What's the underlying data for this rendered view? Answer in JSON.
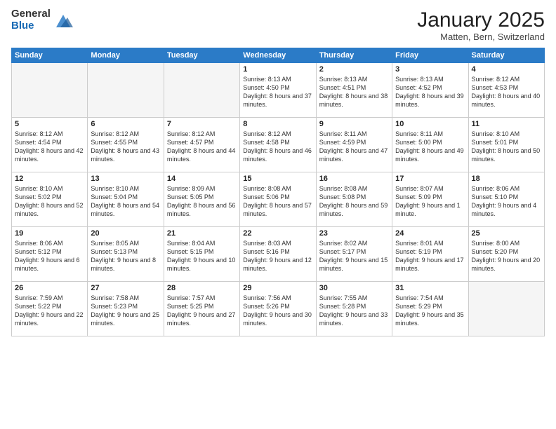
{
  "logo": {
    "general": "General",
    "blue": "Blue"
  },
  "header": {
    "title": "January 2025",
    "location": "Matten, Bern, Switzerland"
  },
  "weekdays": [
    "Sunday",
    "Monday",
    "Tuesday",
    "Wednesday",
    "Thursday",
    "Friday",
    "Saturday"
  ],
  "weeks": [
    [
      {
        "day": "",
        "info": ""
      },
      {
        "day": "",
        "info": ""
      },
      {
        "day": "",
        "info": ""
      },
      {
        "day": "1",
        "info": "Sunrise: 8:13 AM\nSunset: 4:50 PM\nDaylight: 8 hours\nand 37 minutes."
      },
      {
        "day": "2",
        "info": "Sunrise: 8:13 AM\nSunset: 4:51 PM\nDaylight: 8 hours\nand 38 minutes."
      },
      {
        "day": "3",
        "info": "Sunrise: 8:13 AM\nSunset: 4:52 PM\nDaylight: 8 hours\nand 39 minutes."
      },
      {
        "day": "4",
        "info": "Sunrise: 8:12 AM\nSunset: 4:53 PM\nDaylight: 8 hours\nand 40 minutes."
      }
    ],
    [
      {
        "day": "5",
        "info": "Sunrise: 8:12 AM\nSunset: 4:54 PM\nDaylight: 8 hours\nand 42 minutes."
      },
      {
        "day": "6",
        "info": "Sunrise: 8:12 AM\nSunset: 4:55 PM\nDaylight: 8 hours\nand 43 minutes."
      },
      {
        "day": "7",
        "info": "Sunrise: 8:12 AM\nSunset: 4:57 PM\nDaylight: 8 hours\nand 44 minutes."
      },
      {
        "day": "8",
        "info": "Sunrise: 8:12 AM\nSunset: 4:58 PM\nDaylight: 8 hours\nand 46 minutes."
      },
      {
        "day": "9",
        "info": "Sunrise: 8:11 AM\nSunset: 4:59 PM\nDaylight: 8 hours\nand 47 minutes."
      },
      {
        "day": "10",
        "info": "Sunrise: 8:11 AM\nSunset: 5:00 PM\nDaylight: 8 hours\nand 49 minutes."
      },
      {
        "day": "11",
        "info": "Sunrise: 8:10 AM\nSunset: 5:01 PM\nDaylight: 8 hours\nand 50 minutes."
      }
    ],
    [
      {
        "day": "12",
        "info": "Sunrise: 8:10 AM\nSunset: 5:02 PM\nDaylight: 8 hours\nand 52 minutes."
      },
      {
        "day": "13",
        "info": "Sunrise: 8:10 AM\nSunset: 5:04 PM\nDaylight: 8 hours\nand 54 minutes."
      },
      {
        "day": "14",
        "info": "Sunrise: 8:09 AM\nSunset: 5:05 PM\nDaylight: 8 hours\nand 56 minutes."
      },
      {
        "day": "15",
        "info": "Sunrise: 8:08 AM\nSunset: 5:06 PM\nDaylight: 8 hours\nand 57 minutes."
      },
      {
        "day": "16",
        "info": "Sunrise: 8:08 AM\nSunset: 5:08 PM\nDaylight: 8 hours\nand 59 minutes."
      },
      {
        "day": "17",
        "info": "Sunrise: 8:07 AM\nSunset: 5:09 PM\nDaylight: 9 hours\nand 1 minute."
      },
      {
        "day": "18",
        "info": "Sunrise: 8:06 AM\nSunset: 5:10 PM\nDaylight: 9 hours\nand 4 minutes."
      }
    ],
    [
      {
        "day": "19",
        "info": "Sunrise: 8:06 AM\nSunset: 5:12 PM\nDaylight: 9 hours\nand 6 minutes."
      },
      {
        "day": "20",
        "info": "Sunrise: 8:05 AM\nSunset: 5:13 PM\nDaylight: 9 hours\nand 8 minutes."
      },
      {
        "day": "21",
        "info": "Sunrise: 8:04 AM\nSunset: 5:15 PM\nDaylight: 9 hours\nand 10 minutes."
      },
      {
        "day": "22",
        "info": "Sunrise: 8:03 AM\nSunset: 5:16 PM\nDaylight: 9 hours\nand 12 minutes."
      },
      {
        "day": "23",
        "info": "Sunrise: 8:02 AM\nSunset: 5:17 PM\nDaylight: 9 hours\nand 15 minutes."
      },
      {
        "day": "24",
        "info": "Sunrise: 8:01 AM\nSunset: 5:19 PM\nDaylight: 9 hours\nand 17 minutes."
      },
      {
        "day": "25",
        "info": "Sunrise: 8:00 AM\nSunset: 5:20 PM\nDaylight: 9 hours\nand 20 minutes."
      }
    ],
    [
      {
        "day": "26",
        "info": "Sunrise: 7:59 AM\nSunset: 5:22 PM\nDaylight: 9 hours\nand 22 minutes."
      },
      {
        "day": "27",
        "info": "Sunrise: 7:58 AM\nSunset: 5:23 PM\nDaylight: 9 hours\nand 25 minutes."
      },
      {
        "day": "28",
        "info": "Sunrise: 7:57 AM\nSunset: 5:25 PM\nDaylight: 9 hours\nand 27 minutes."
      },
      {
        "day": "29",
        "info": "Sunrise: 7:56 AM\nSunset: 5:26 PM\nDaylight: 9 hours\nand 30 minutes."
      },
      {
        "day": "30",
        "info": "Sunrise: 7:55 AM\nSunset: 5:28 PM\nDaylight: 9 hours\nand 33 minutes."
      },
      {
        "day": "31",
        "info": "Sunrise: 7:54 AM\nSunset: 5:29 PM\nDaylight: 9 hours\nand 35 minutes."
      },
      {
        "day": "",
        "info": ""
      }
    ]
  ]
}
